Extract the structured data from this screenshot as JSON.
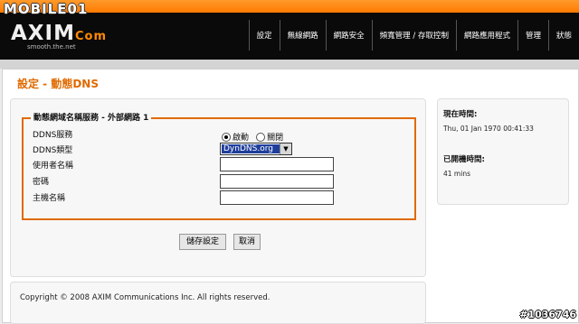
{
  "watermark": "MOBILE01",
  "header": {
    "logo_text": "AXIM",
    "logo_suffix": "Com",
    "logo_tagline": "smooth.the.net",
    "nav": [
      "設定",
      "無線網路",
      "網路安全",
      "頻寬管理 / 存取控制",
      "網路應用程式",
      "管理",
      "狀態"
    ]
  },
  "page_title": "設定 - 動態DNS",
  "section": {
    "legend": "動態網域名稱服務 - 外部網路 1",
    "rows": {
      "ddns_service": "DDNS服務",
      "ddns_type": "DDNS類型",
      "username": "使用者名稱",
      "password": "密碼",
      "hostname": "主機名稱"
    },
    "radio_enable": "啟動",
    "radio_disable": "關閉",
    "radio_selected": "啟動",
    "select_value": "DynDNS.org"
  },
  "buttons": {
    "save": "儲存設定",
    "cancel": "取消"
  },
  "footer": {
    "copyright": "Copyright © 2008 AXIM Communications Inc. All rights reserved."
  },
  "side": {
    "current_time_label": "現在時間:",
    "current_time_value": "Thu, 01 Jan 1970 00:41:33",
    "uptime_label": "已開機時間:",
    "uptime_value": "41 mins"
  },
  "stamp": "#1036746",
  "colors": {
    "accent": "#e06a00",
    "header_bg": "#0a0a0a",
    "header_top": "#ff8a00"
  }
}
